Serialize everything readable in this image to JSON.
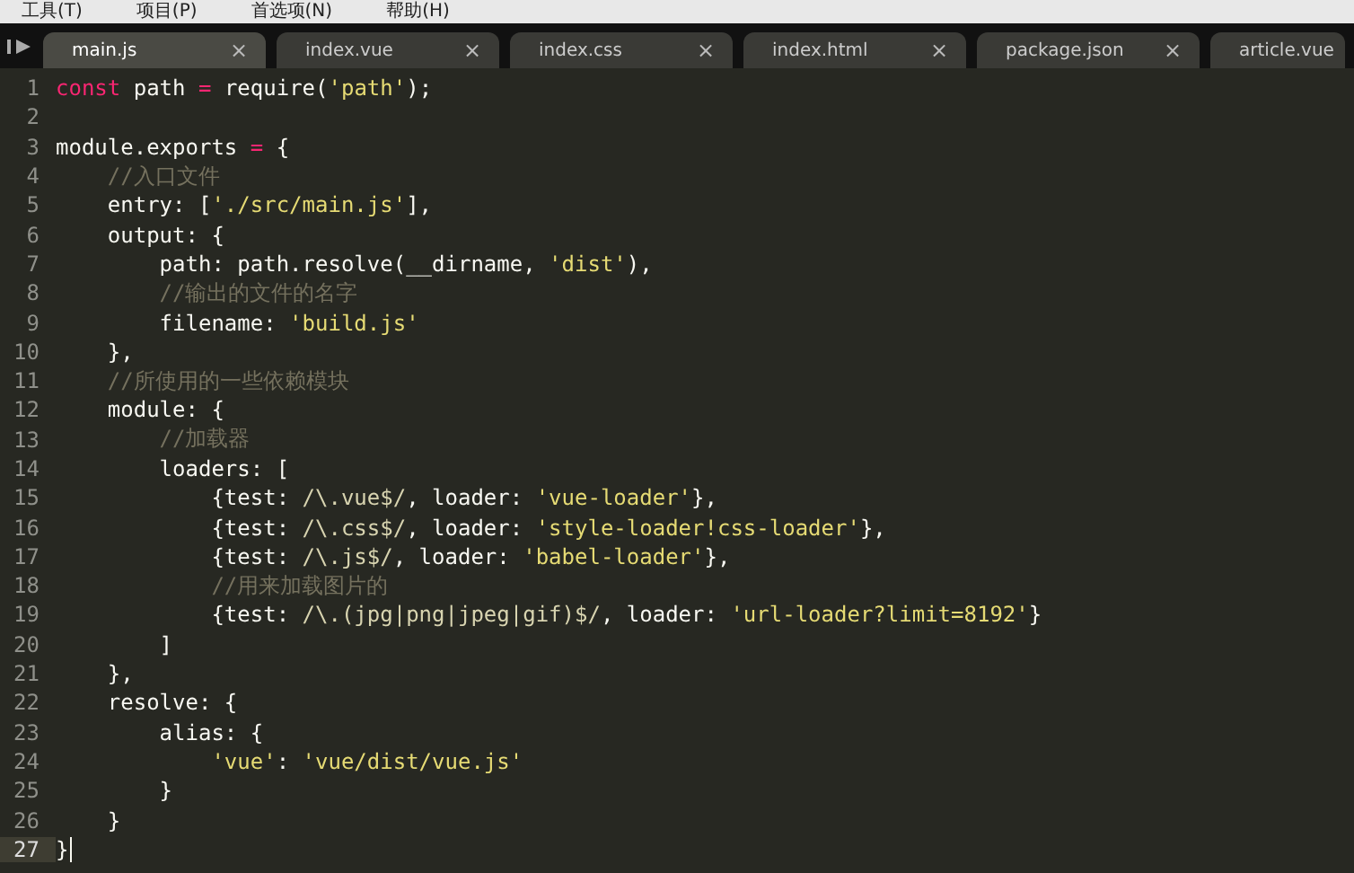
{
  "menu": [
    "工具(T)",
    "项目(P)",
    "首选项(N)",
    "帮助(H)"
  ],
  "tabs": [
    {
      "label": "main.js",
      "close": "×",
      "selected": true
    },
    {
      "label": "index.vue",
      "close": "×",
      "selected": false
    },
    {
      "label": "index.css",
      "close": "×",
      "selected": false
    },
    {
      "label": "index.html",
      "close": "×",
      "selected": false
    },
    {
      "label": "package.json",
      "close": "×",
      "selected": false
    },
    {
      "label": "article.vue",
      "selected": false
    }
  ],
  "lines": [
    {
      "number": "1",
      "current": false,
      "tokens": [
        {
          "kind": "keyword",
          "text": "const"
        },
        {
          "kind": "plain",
          "text": " path "
        },
        {
          "kind": "operator",
          "text": "="
        },
        {
          "kind": "plain",
          "text": " require("
        },
        {
          "kind": "string",
          "text": "'path'"
        },
        {
          "kind": "plain",
          "text": ");"
        }
      ]
    },
    {
      "number": "2",
      "current": false
    },
    {
      "number": "3",
      "current": false,
      "tokens": [
        {
          "kind": "plain",
          "text": "module.exports "
        },
        {
          "kind": "operator",
          "text": "="
        },
        {
          "kind": "plain",
          "text": " {"
        }
      ]
    },
    {
      "number": "4",
      "current": false,
      "tokens": [
        {
          "kind": "comment",
          "text": "    //入口文件"
        }
      ]
    },
    {
      "number": "5",
      "current": false,
      "tokens": [
        {
          "kind": "plain",
          "text": "    entry: ["
        },
        {
          "kind": "string",
          "text": "'./src/main.js'"
        },
        {
          "kind": "plain",
          "text": "],"
        }
      ]
    },
    {
      "number": "6",
      "current": false,
      "tokens": [
        {
          "kind": "plain",
          "text": "    output: {"
        }
      ]
    },
    {
      "number": "7",
      "current": false,
      "tokens": [
        {
          "kind": "plain",
          "text": "        path: path.resolve(__dirname, "
        },
        {
          "kind": "string",
          "text": "'dist'"
        },
        {
          "kind": "plain",
          "text": "),"
        }
      ]
    },
    {
      "number": "8",
      "current": false,
      "tokens": [
        {
          "kind": "comment",
          "text": "        //输出的文件的名字"
        }
      ]
    },
    {
      "number": "9",
      "current": false,
      "tokens": [
        {
          "kind": "plain",
          "text": "        filename: "
        },
        {
          "kind": "string",
          "text": "'build.js'"
        }
      ]
    },
    {
      "number": "10",
      "current": false,
      "tokens": [
        {
          "kind": "plain",
          "text": "    },"
        }
      ]
    },
    {
      "number": "11",
      "current": false,
      "tokens": [
        {
          "kind": "comment",
          "text": "    //所使用的一些依赖模块"
        }
      ]
    },
    {
      "number": "12",
      "current": false,
      "tokens": [
        {
          "kind": "plain",
          "text": "    module: {"
        }
      ]
    },
    {
      "number": "13",
      "current": false,
      "tokens": [
        {
          "kind": "comment",
          "text": "        //加载器"
        }
      ]
    },
    {
      "number": "14",
      "current": false,
      "tokens": [
        {
          "kind": "plain",
          "text": "        loaders: ["
        }
      ]
    },
    {
      "number": "15",
      "current": false,
      "tokens": [
        {
          "kind": "plain",
          "text": "            {test: "
        },
        {
          "kind": "regex",
          "text": "/\\.vue$/"
        },
        {
          "kind": "plain",
          "text": ", loader: "
        },
        {
          "kind": "string",
          "text": "'vue-loader'"
        },
        {
          "kind": "plain",
          "text": "},"
        }
      ]
    },
    {
      "number": "16",
      "current": false,
      "tokens": [
        {
          "kind": "plain",
          "text": "            {test: "
        },
        {
          "kind": "regex",
          "text": "/\\.css$/"
        },
        {
          "kind": "plain",
          "text": ", loader: "
        },
        {
          "kind": "string",
          "text": "'style-loader!css-loader'"
        },
        {
          "kind": "plain",
          "text": "},"
        }
      ]
    },
    {
      "number": "17",
      "current": false,
      "tokens": [
        {
          "kind": "plain",
          "text": "            {test: "
        },
        {
          "kind": "regex",
          "text": "/\\.js$/"
        },
        {
          "kind": "plain",
          "text": ", loader: "
        },
        {
          "kind": "string",
          "text": "'babel-loader'"
        },
        {
          "kind": "plain",
          "text": "},"
        }
      ]
    },
    {
      "number": "18",
      "current": false,
      "tokens": [
        {
          "kind": "comment",
          "text": "            //用来加载图片的"
        }
      ]
    },
    {
      "number": "19",
      "current": false,
      "tokens": [
        {
          "kind": "plain",
          "text": "            {test: "
        },
        {
          "kind": "regex",
          "text": "/\\.(jpg|png|jpeg|gif)$/"
        },
        {
          "kind": "plain",
          "text": ", loader: "
        },
        {
          "kind": "string",
          "text": "'url-loader?limit=8192'"
        },
        {
          "kind": "plain",
          "text": "}"
        }
      ]
    },
    {
      "number": "20",
      "current": false,
      "tokens": [
        {
          "kind": "plain",
          "text": "        ]"
        }
      ]
    },
    {
      "number": "21",
      "current": false,
      "tokens": [
        {
          "kind": "plain",
          "text": "    },"
        }
      ]
    },
    {
      "number": "22",
      "current": false,
      "tokens": [
        {
          "kind": "plain",
          "text": "    resolve: {"
        }
      ]
    },
    {
      "number": "23",
      "current": false,
      "tokens": [
        {
          "kind": "plain",
          "text": "        alias: {"
        }
      ]
    },
    {
      "number": "24",
      "current": false,
      "tokens": [
        {
          "kind": "string",
          "text": "            'vue'"
        },
        {
          "kind": "plain",
          "text": ": "
        },
        {
          "kind": "string",
          "text": "'vue/dist/vue.js'"
        }
      ]
    },
    {
      "number": "25",
      "current": false,
      "tokens": [
        {
          "kind": "plain",
          "text": "        }"
        }
      ]
    },
    {
      "number": "26",
      "current": false,
      "tokens": [
        {
          "kind": "plain",
          "text": "    }"
        }
      ]
    },
    {
      "number": "27",
      "current": true,
      "tokens": [
        {
          "kind": "plain",
          "text": "}"
        }
      ]
    }
  ]
}
